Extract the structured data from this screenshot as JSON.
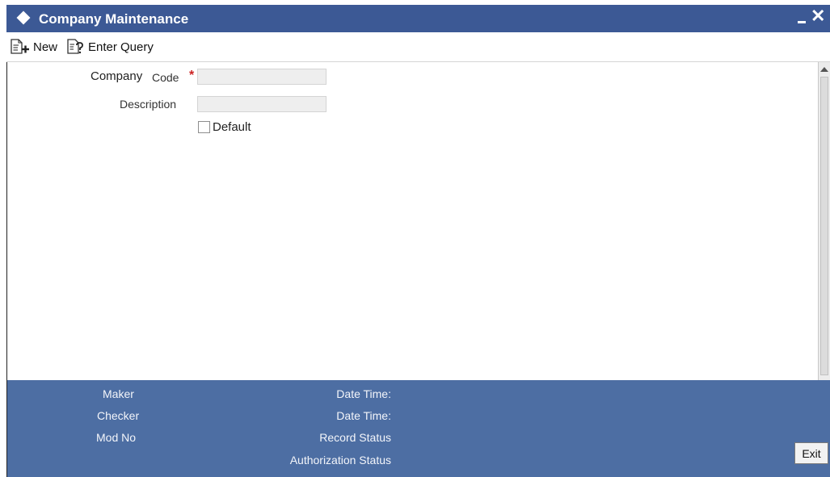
{
  "window": {
    "title": "Company Maintenance"
  },
  "toolbar": {
    "new_label": "New",
    "enter_query_label": "Enter Query"
  },
  "form": {
    "company_label": "Company",
    "code_label": "Code",
    "required_marker": "*",
    "code_value": "",
    "description_label": "Description",
    "description_value": "",
    "default_label": "Default",
    "default_checked": false
  },
  "audit": {
    "maker_label": "Maker",
    "checker_label": "Checker",
    "mod_no_label": "Mod No",
    "date_time_label_1": "Date Time:",
    "date_time_label_2": "Date Time:",
    "record_status_label": "Record Status",
    "authorization_status_label": "Authorization Status"
  },
  "buttons": {
    "exit_label": "Exit"
  },
  "colors": {
    "titlebar": "#3c5995",
    "audit_panel": "#4d6ea3",
    "required": "#cc2222"
  }
}
